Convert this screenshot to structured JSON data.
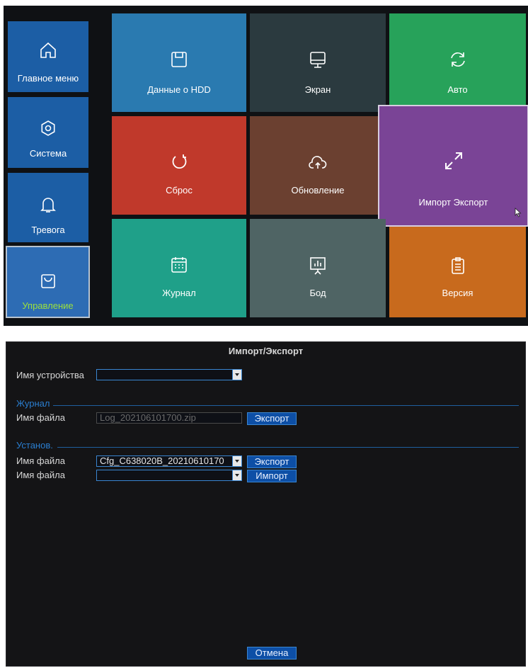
{
  "menu": {
    "sidebar": [
      {
        "label": "Главное меню",
        "icon": "home-icon"
      },
      {
        "label": "Система",
        "icon": "gear-icon"
      },
      {
        "label": "Тревога",
        "icon": "bell-icon"
      },
      {
        "label": "Управление",
        "icon": "bag-icon"
      }
    ],
    "tiles": [
      {
        "label": "Данные о HDD",
        "icon": "floppy-icon",
        "color": "#2a7ab0"
      },
      {
        "label": "Экран",
        "icon": "monitor-icon",
        "color": "#2b3a3f"
      },
      {
        "label": "Авто",
        "icon": "refresh-icon",
        "color": "#27a25a"
      },
      {
        "label": "Сброс",
        "icon": "reset-icon",
        "color": "#c0392b"
      },
      {
        "label": "Обновление",
        "icon": "cloud-upload-icon",
        "color": "#6b4030"
      },
      {
        "label": "Импорт Экспорт",
        "icon": "expand-icon",
        "color": "#7a4496"
      },
      {
        "label": "Журнал",
        "icon": "calendar-icon",
        "color": "#1fa089"
      },
      {
        "label": "Бод",
        "icon": "presentation-icon",
        "color": "#4f6464"
      },
      {
        "label": "Версия",
        "icon": "clipboard-icon",
        "color": "#c86a1d"
      }
    ]
  },
  "dialog": {
    "title": "Импорт/Экспорт",
    "device_label": "Имя устройства",
    "device_value": "",
    "log_section": "Журнал",
    "log_file_label": "Имя файла",
    "log_file_value": "Log_202106101700.zip",
    "export_label": "Экспорт",
    "settings_section": "Установ.",
    "cfg_file_label": "Имя файла",
    "cfg_file_value": "Cfg_C638020B_20210610170",
    "import_file_label": "Имя файла",
    "import_file_value": "",
    "import_label": "Импорт",
    "cancel_label": "Отмена"
  },
  "colors": {
    "sidebar": "#1c5ea5",
    "accent_blue": "#3a86d1",
    "active_label": "#9ce03c"
  }
}
